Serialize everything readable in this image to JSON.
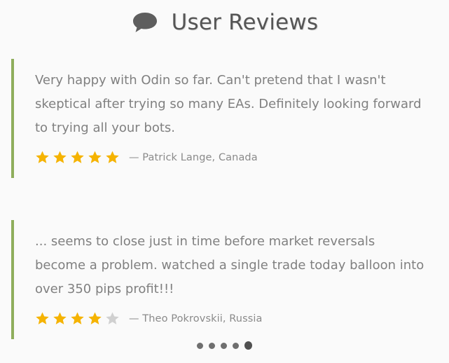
{
  "header": {
    "title": "User Reviews",
    "icon": "chat-bubble-icon"
  },
  "reviews": [
    {
      "text": "Very happy with Odin so far. Can't pretend that I wasn't skeptical after trying so many EAs. Definitely looking forward to trying all your bots.",
      "rating": 5,
      "max_rating": 5,
      "author": "— Patrick Lange, Canada"
    },
    {
      "text": "... seems to close just in time before market reversals become a problem. watched a single trade today balloon into over 350 pips profit!!!",
      "rating": 4,
      "max_rating": 5,
      "author": "— Theo Pokrovskii, Russia"
    }
  ],
  "pager": {
    "count": 5,
    "active_index": 4
  },
  "colors": {
    "accent_border": "#8fae5c",
    "star_filled": "#f5b301",
    "star_empty": "#d0d0d0",
    "text": "#808080",
    "title": "#555555"
  }
}
